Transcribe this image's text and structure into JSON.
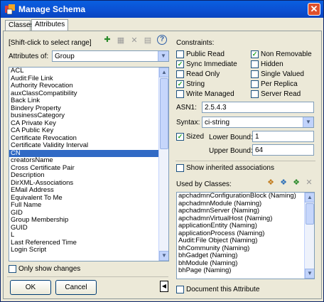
{
  "window": {
    "title": "Manage Schema",
    "close_glyph": "✕"
  },
  "tabs": [
    {
      "label": "Classes"
    },
    {
      "label": "Attributes"
    }
  ],
  "left": {
    "range_hint": "[Shift-click to select range]",
    "attributes_of_label": "Attributes of:",
    "attributes_of_value": "Group",
    "list": [
      "ACL",
      "Audit:File Link",
      "Authority Revocation",
      "auxClassCompatibility",
      "Back Link",
      "Bindery Property",
      "businessCategory",
      "CA Private Key",
      "CA Public Key",
      "Certificate Revocation",
      "Certificate Validity Interval",
      "CN",
      "creatorsName",
      "Cross Certificate Pair",
      "Description",
      "DirXML-Associations",
      "EMail Address",
      "Equivalent To Me",
      "Full Name",
      "GID",
      "Group Membership",
      "GUID",
      "L",
      "Last Referenced Time",
      "Login Script"
    ],
    "selected_index": 11,
    "only_show_changes": "Only show changes",
    "ok": "OK",
    "cancel": "Cancel"
  },
  "right": {
    "constraints_label": "Constraints:",
    "checks": [
      {
        "label": "Public Read",
        "checked": false
      },
      {
        "label": "Non Removable",
        "checked": true
      },
      {
        "label": "Sync Immediate",
        "checked": true
      },
      {
        "label": "Hidden",
        "checked": false
      },
      {
        "label": "Read Only",
        "checked": false
      },
      {
        "label": "Single Valued",
        "checked": false
      },
      {
        "label": "String",
        "checked": true
      },
      {
        "label": "Per Replica",
        "checked": false
      },
      {
        "label": "Write Managed",
        "checked": false
      },
      {
        "label": "Server Read",
        "checked": false
      }
    ],
    "asn1_label": "ASN1:",
    "asn1_value": "2.5.4.3",
    "syntax_label": "Syntax:",
    "syntax_value": "ci-string",
    "sized_label": "Sized",
    "sized_checked": true,
    "lower_label": "Lower Bound:",
    "lower_value": "1",
    "upper_label": "Upper Bound:",
    "upper_value": "64",
    "show_inherited": "Show inherited associations",
    "used_by_label": "Used by Classes:",
    "used_by_list": [
      "apchadmnConfigurationBlock (Naming)",
      "apchadmnModule (Naming)",
      "apchadmnServer (Naming)",
      "apchadmnVirtualHost (Naming)",
      "applicationEntity (Naming)",
      "applicationProcess (Naming)",
      "Audit:File Object (Naming)",
      "bhCommunity (Naming)",
      "bhGadget (Naming)",
      "bhModule (Naming)",
      "bhPage (Naming)"
    ],
    "document_attr": "Document this Attribute",
    "collapse_glyph": "◀"
  },
  "colors": {
    "titlebar": "#0b4fd1",
    "selection": "#316ac5",
    "check": "#21a121"
  }
}
